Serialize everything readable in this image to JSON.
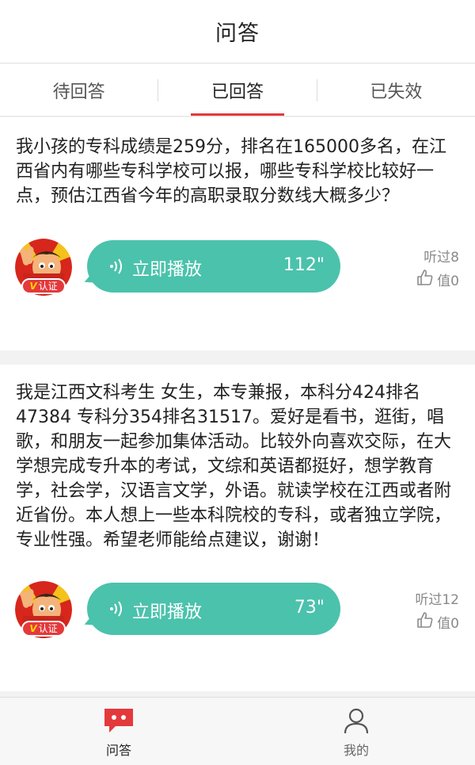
{
  "header": {
    "title": "问答"
  },
  "tabs": [
    {
      "label": "待回答"
    },
    {
      "label": "已回答"
    },
    {
      "label": "已失效"
    }
  ],
  "questions": [
    {
      "text": "我小孩的专科成绩是259分，排名在165000多名，在江西省内有哪些专科学校可以报，哪些专科学校比较好一点，预估江西省今年的高职录取分数线大概多少？",
      "badge": "认证",
      "play_label": "立即播放",
      "duration": "112\"",
      "listens": "听过8",
      "likes": "值0"
    },
    {
      "text": "我是江西文科考生 女生，本专兼报，本科分424排名47384 专科分354排名31517。爱好是看书，逛街，唱歌，和朋友一起参加集体活动。比较外向喜欢交际，在大学想完成专升本的考试，文综和英语都挺好，想学教育学，社会学，汉语言文学，外语。就读学校在江西或者附近省份。本人想上一些本科院校的专科，或者独立学院，专业性强。希望老师能给点建议，谢谢！",
      "badge": "认证",
      "play_label": "立即播放",
      "duration": "73\"",
      "listens": "听过12",
      "likes": "值0"
    }
  ],
  "bottom_nav": [
    {
      "label": "问答",
      "icon": "chat-bubble-icon"
    },
    {
      "label": "我的",
      "icon": "user-icon"
    }
  ],
  "colors": {
    "accent": "#e4393c",
    "play": "#4bc2ac"
  }
}
